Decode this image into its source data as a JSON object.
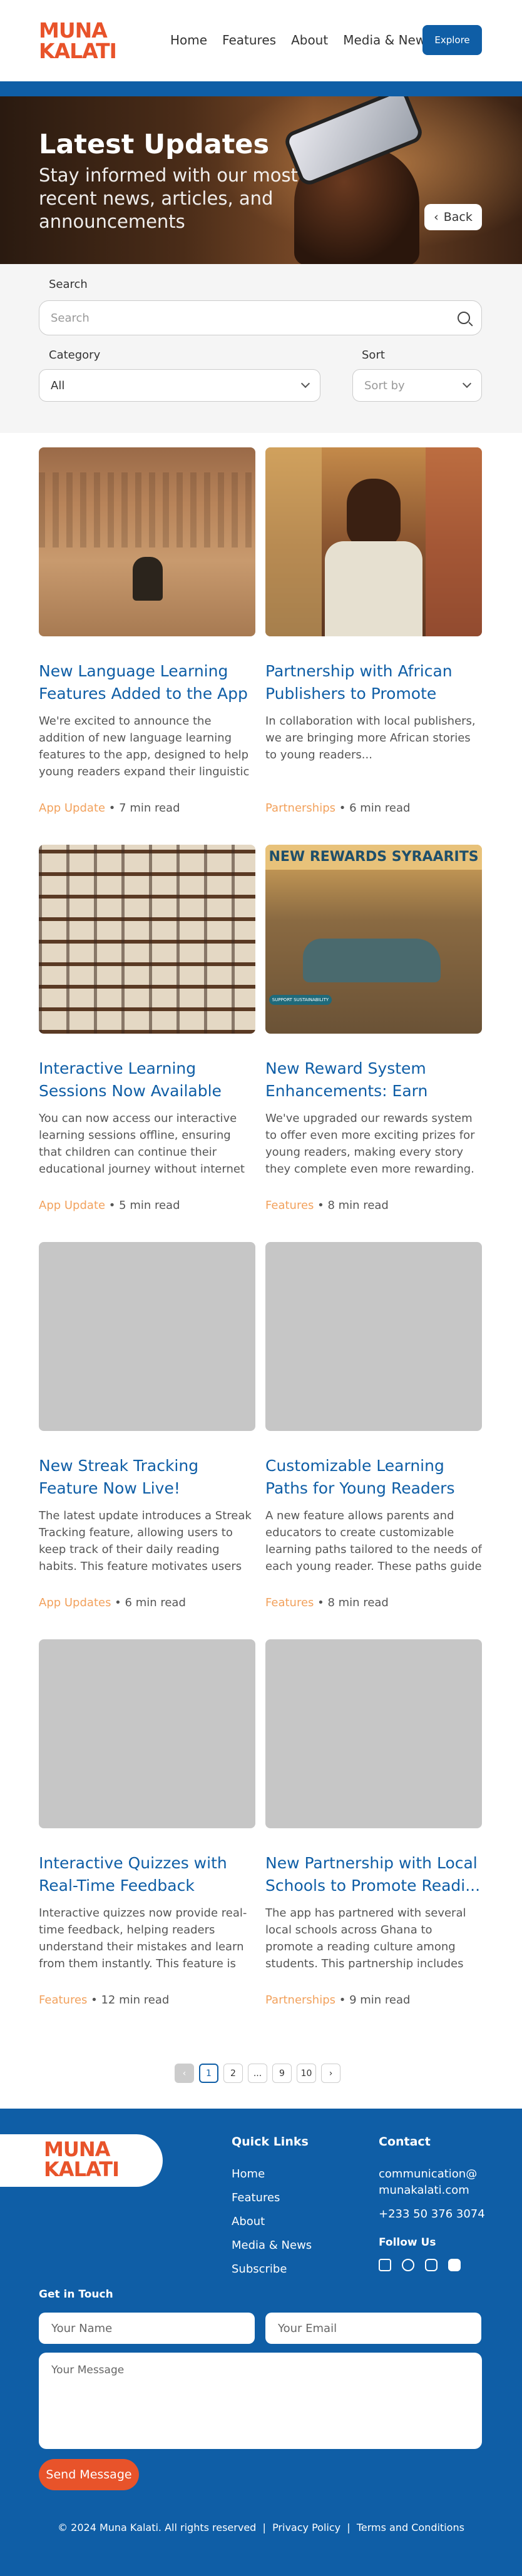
{
  "brand": {
    "logo_line1": "MUNA",
    "logo_line2": "KALATI",
    "accent": "#0f5ea6",
    "orange": "#e8532a"
  },
  "nav": {
    "items": [
      "Home",
      "Features",
      "About",
      "Media & News"
    ],
    "cta": "Explore"
  },
  "hero": {
    "title": "Latest Updates",
    "subtitle": "Stay informed with our most recent news, articles, and announcements",
    "back_label": "Back"
  },
  "filters": {
    "search_label": "Search",
    "search_placeholder": "Search",
    "category_label": "Category",
    "category_value": "All",
    "sort_label": "Sort",
    "sort_placeholder": "Sort by"
  },
  "cards": [
    {
      "title": "New Language Learning Features Added to the App",
      "desc": "We're excited to announce the addition of new language learning features to the app, designed to help young readers expand their linguistic skills while enjoying their favorite sto...",
      "category": "App Update",
      "read": "7 min read"
    },
    {
      "title": "Partnership with African Publishers to Promote Loc...",
      "desc": "In collaboration with local publishers, we are bringing more African stories to young readers...",
      "category": "Partnerships",
      "read": "6 min read"
    },
    {
      "title": "Interactive Learning Sessions Now Available for...",
      "desc": "You can now access our interactive learning sessions offline, ensuring that children can continue their educational journey without internet interruptions.",
      "category": "App Update",
      "read": "5 min read"
    },
    {
      "title": "New Reward System Enhancements: Earn More...",
      "desc": "We've upgraded our rewards system to offer even more exciting prizes for young readers, making every story they complete even more rewarding.",
      "category": "Features",
      "read": "8 min read"
    },
    {
      "title": "New Streak Tracking Feature Now Live!",
      "desc": "The latest update introduces a Streak Tracking feature, allowing users to keep track of their daily reading habits. This feature motivates users to maintain a consistent reading sched...",
      "category": "App Updates",
      "read": "6 min read"
    },
    {
      "title": "Customizable Learning Paths for Young Readers",
      "desc": "A new feature allows parents and educators to create customizable learning paths tailored to the needs of each young reader. These paths guide readers through a series of stories, q...",
      "category": "Features",
      "read": "8 min read"
    },
    {
      "title": "Interactive Quizzes with Real-Time Feedback",
      "desc": "Interactive quizzes now provide real-time feedback, helping readers understand their mistakes and learn from them instantly. This feature is designed to reinforce learning and...",
      "category": "Features",
      "read": "12 min read"
    },
    {
      "title": "New Partnership with Local Schools to Promote Readi...",
      "desc": "The app has partnered with several local schools across Ghana to promote a reading culture among students. This partnership includes providing free access to premium co...",
      "category": "Partnerships",
      "read": "9 min read"
    }
  ],
  "card_image_text": {
    "poster_top": "NEW REWARDS SYRAARITS",
    "poster_btn": "SUPPORT SUSTAINABILITY"
  },
  "pagination": {
    "pages": [
      "1",
      "2",
      "...",
      "9",
      "10"
    ],
    "prev": "‹",
    "next": "›"
  },
  "footer": {
    "quick_links_title": "Quick Links",
    "quick_links": [
      "Home",
      "Features",
      "About",
      "Media & News",
      "Subscribe"
    ],
    "contact_title": "Contact",
    "email_line1": "communication@",
    "email_line2": "munakalati.com",
    "phone": "+233 50 376 3074",
    "follow_title": "Follow Us",
    "social_icons": [
      "linkedin-icon",
      "facebook-icon",
      "instagram-icon",
      "youtube-icon"
    ],
    "get_in_touch": "Get in Touch",
    "name_placeholder": "Your Name",
    "email_placeholder": "Your Email",
    "message_placeholder": "Your Message",
    "send_label": "Send Message",
    "copyright": "© 2024 Muna Kalati. All rights reserved",
    "privacy": "Privacy Policy",
    "terms": "Terms and Conditions",
    "sep": "|"
  }
}
